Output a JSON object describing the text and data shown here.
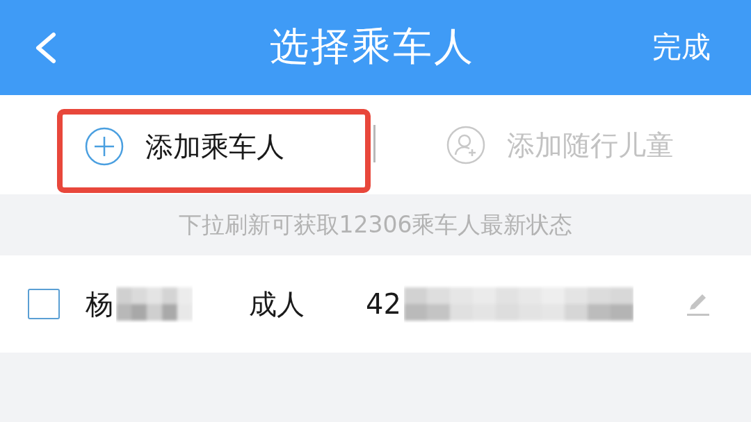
{
  "header": {
    "title": "选择乘车人",
    "action": "完成"
  },
  "actions": [
    {
      "label": "添加乘车人",
      "kind": "add",
      "disabled": false,
      "highlighted": true
    },
    {
      "label": "添加随行儿童",
      "kind": "child",
      "disabled": true,
      "highlighted": false
    }
  ],
  "hint": "下拉刷新可获取12306乘车人最新状态",
  "passengers": [
    {
      "name": "杨",
      "type": "成人",
      "id_number": "42",
      "checked": false,
      "redacted": true
    }
  ]
}
